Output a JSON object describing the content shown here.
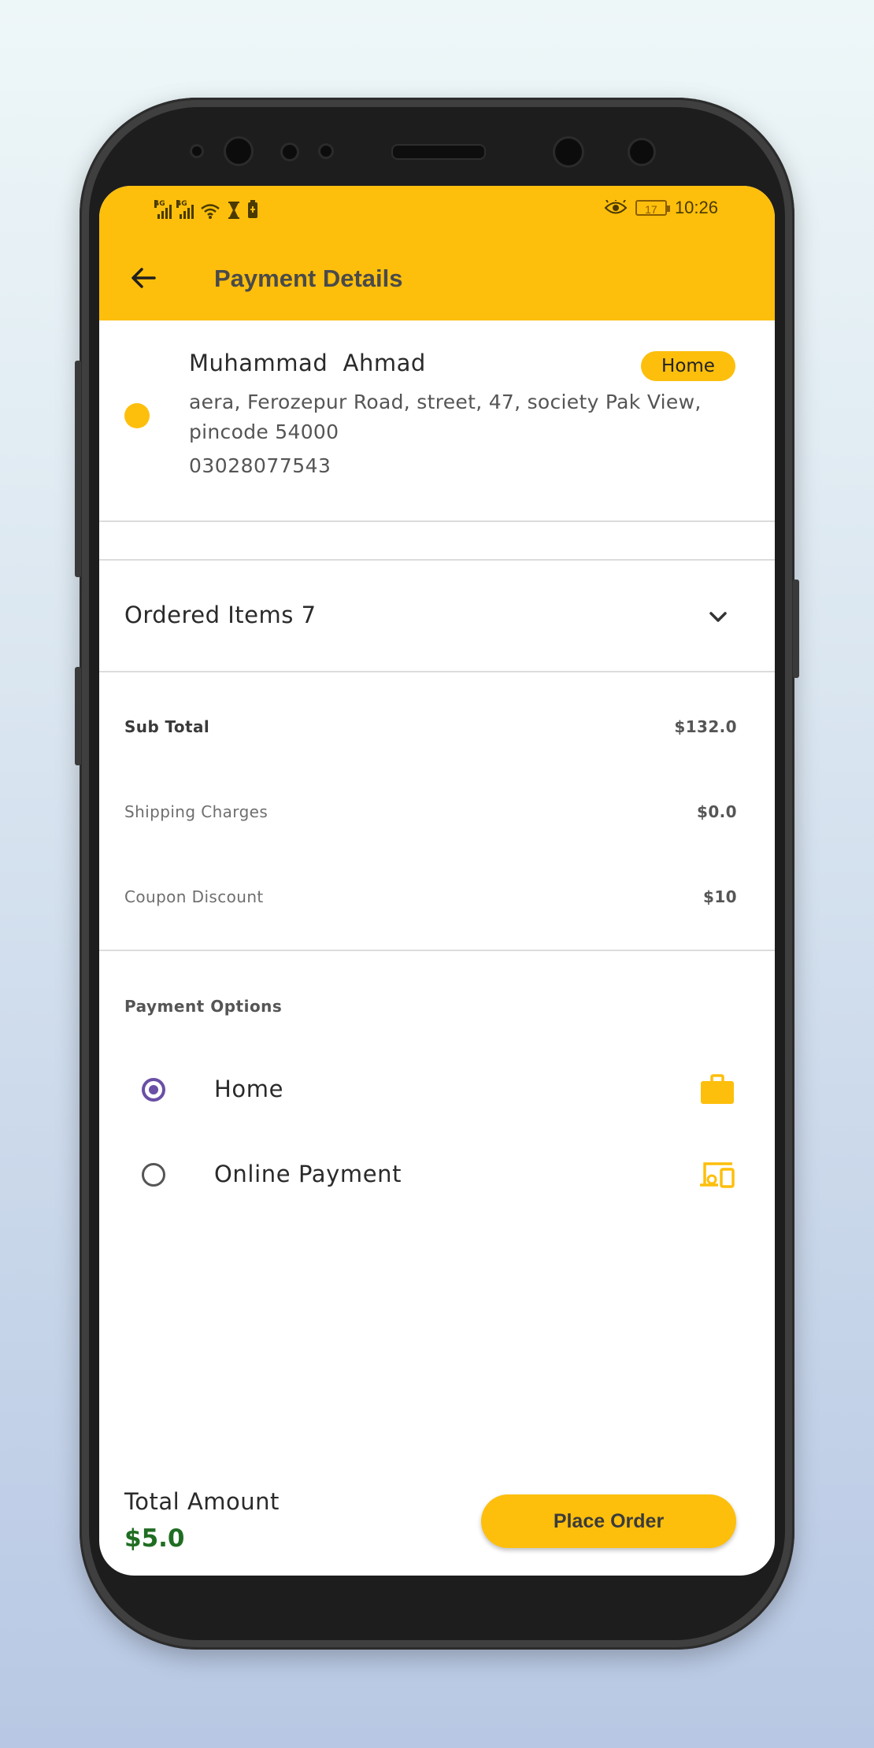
{
  "status_bar": {
    "network_1": "4G",
    "network_2": "4G",
    "battery_level": "17",
    "time": "10:26"
  },
  "appbar": {
    "title": "Payment Details",
    "back_icon": "arrow-left-icon"
  },
  "address": {
    "name": "Muhammad  Ahmad",
    "badge": "Home",
    "line": "aera, Ferozepur Road, street, 47, society Pak View, pincode 54000",
    "phone": "03028077543"
  },
  "ordered_items": {
    "label": "Ordered Items 7",
    "icon": "chevron-down-icon"
  },
  "summary": [
    {
      "label": "Sub Total",
      "value": "$132.0"
    },
    {
      "label": "Shipping Charges",
      "value": "$0.0"
    },
    {
      "label": "Coupon Discount",
      "value": "$10"
    }
  ],
  "payment": {
    "title": "Payment Options",
    "options": [
      {
        "label": "Home",
        "selected": true,
        "icon": "briefcase-icon"
      },
      {
        "label": "Online Payment",
        "selected": false,
        "icon": "devices-icon"
      }
    ]
  },
  "footer": {
    "total_label": "Total Amount",
    "total_value": "$5.0",
    "place_order": "Place Order"
  },
  "colors": {
    "accent": "#fdbf0c",
    "radio_selected": "#6a4fa6",
    "total_value": "#1f6d22"
  }
}
